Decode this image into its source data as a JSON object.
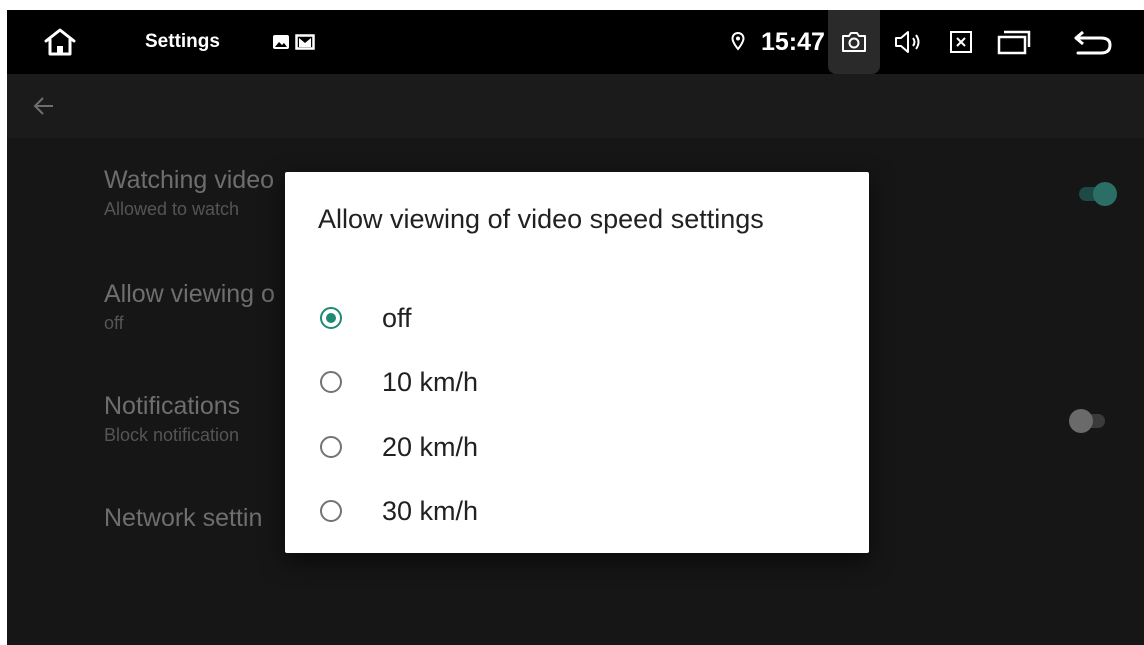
{
  "statusbar": {
    "title": "Settings",
    "time": "15:47"
  },
  "icons": {
    "home": "home-icon",
    "gallery": "image-icon",
    "notification": "gmail-icon",
    "location": "location-icon",
    "screenshot": "camera-icon",
    "volume": "volume-icon",
    "close": "close-window-icon",
    "recents": "recent-apps-icon",
    "back": "back-icon"
  },
  "settings_list": {
    "items": [
      {
        "title": "Watching video",
        "subtitle": "Allowed to watch",
        "toggle_on": true
      },
      {
        "title": "Allow viewing o",
        "subtitle": "off"
      },
      {
        "title": "Notifications",
        "subtitle": "Block notification",
        "toggle_on": false
      },
      {
        "title": "Network settin"
      }
    ]
  },
  "dialog": {
    "title": "Allow viewing of video speed settings",
    "options": [
      {
        "label": "off",
        "selected": true
      },
      {
        "label": "10 km/h",
        "selected": false
      },
      {
        "label": "20 km/h",
        "selected": false
      },
      {
        "label": "30 km/h",
        "selected": false
      }
    ]
  },
  "colors": {
    "accent": "#1e8a73",
    "toggle_on_thumb": "#2b6e66",
    "toggle_on_track": "#1d4a44",
    "toggle_off_thumb": "#6a6a6a",
    "toggle_off_track": "#3a3a3a"
  }
}
